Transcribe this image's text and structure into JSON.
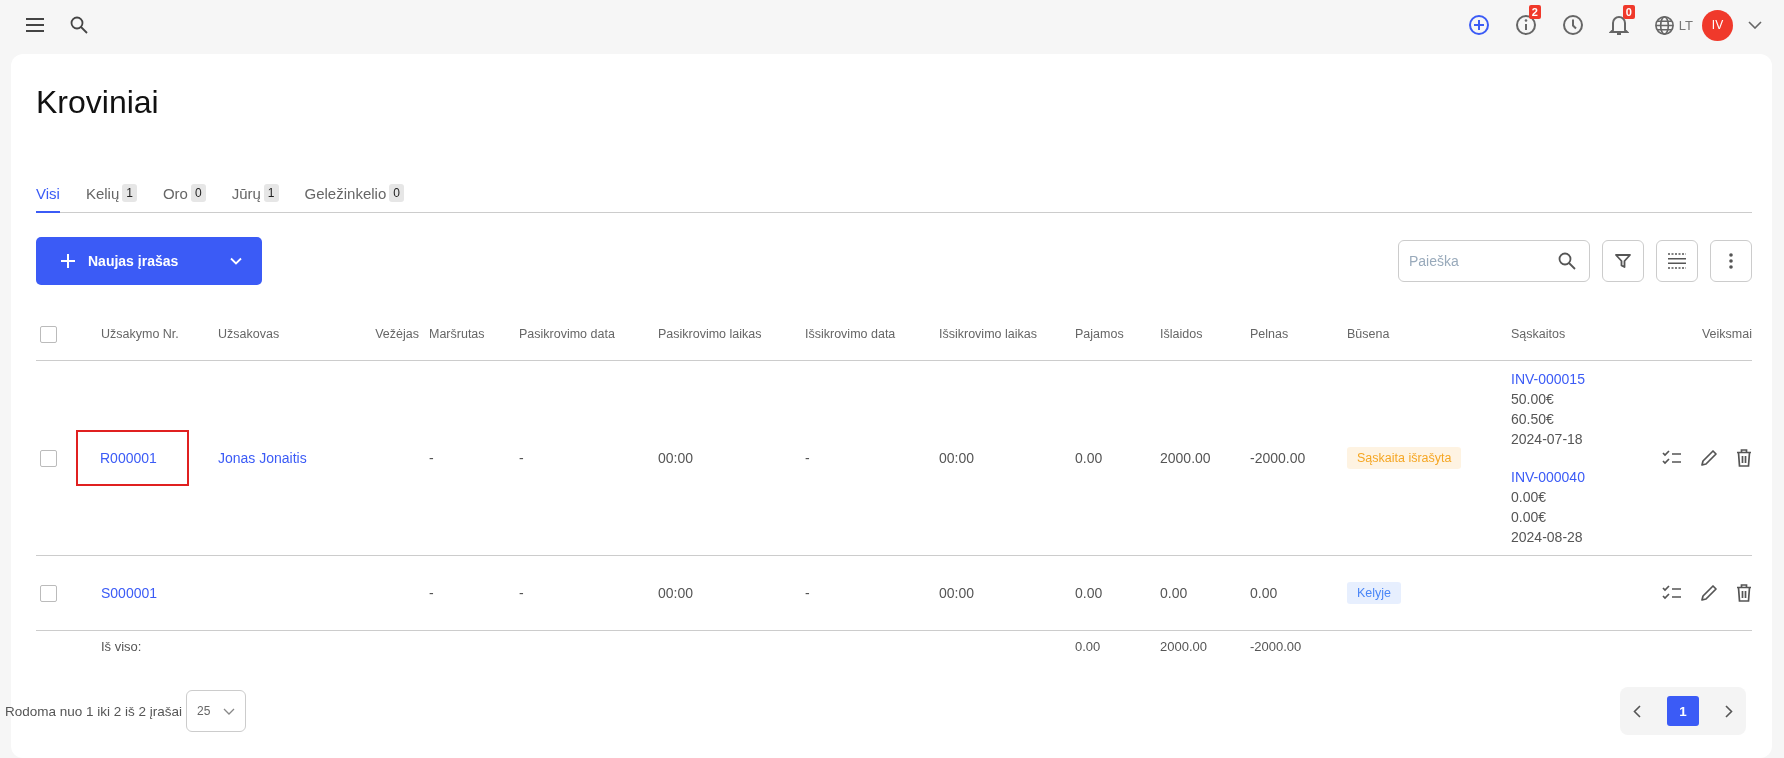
{
  "topbar": {
    "info_count": "2",
    "notifications_count": "0",
    "language": "LT",
    "avatar": "IV"
  },
  "page": {
    "title": "Kroviniai"
  },
  "tabs": [
    {
      "label": "Visi",
      "selected": true
    },
    {
      "label": "Kelių",
      "count": "1",
      "selected": false
    },
    {
      "label": "Oro",
      "count": "0",
      "selected": false
    },
    {
      "label": "Jūrų",
      "count": "1",
      "selected": false
    },
    {
      "label": "Geležinkelio",
      "count": "0",
      "selected": false
    }
  ],
  "new_button": "Naujas įrašas",
  "search": {
    "placeholder": "Paieška"
  },
  "table": {
    "select_all_checked": false,
    "columns": [
      "Užsakymo Nr.",
      "Užsakovas",
      "Vežėjas",
      "Maršrutas",
      "Pasikrovimo data",
      "Pasikrovimo laikas",
      "Išsikrovimo data",
      "Išsikrovimo laikas",
      "Pajamos",
      "Išlaidos",
      "Pelnas",
      "Būsena",
      "Sąskaitos",
      "Veiksmai"
    ],
    "rows": [
      {
        "checked": false,
        "order": "R000001",
        "highlighted": true,
        "client": "Jonas Jonaitis",
        "carrier": "",
        "route": "-",
        "load_date": "-",
        "load_time": "00:00",
        "unload_date": "-",
        "unload_time": "00:00",
        "income": "0.00",
        "expenses": "2000.00",
        "profit": "-2000.00",
        "status": {
          "label": "Sąskaita išrašyta",
          "color": "#f5a623"
        },
        "invoices": [
          {
            "number": "INV-000015",
            "lines": [
              "50.00€",
              "60.50€",
              "2024-07-18"
            ]
          },
          {
            "number": "INV-000040",
            "lines": [
              "0.00€",
              "0.00€",
              "2024-08-28"
            ]
          }
        ]
      },
      {
        "checked": false,
        "order": "S000001",
        "highlighted": false,
        "client": "",
        "carrier": "",
        "route": "-",
        "load_date": "-",
        "load_time": "00:00",
        "unload_date": "-",
        "unload_time": "00:00",
        "income": "0.00",
        "expenses": "0.00",
        "profit": "0.00",
        "status": {
          "label": "Kelyje",
          "color": "#4a86f7"
        },
        "invoices": []
      }
    ],
    "totals": {
      "label": "Iš viso:",
      "income": "0.00",
      "expenses": "2000.00",
      "profit": "-2000.00"
    }
  },
  "footer": {
    "summary": "Rodoma nuo 1 iki 2 iš 2 įrašai",
    "page_size": "25",
    "pages": [
      {
        "label": "1",
        "selected": true
      }
    ]
  }
}
